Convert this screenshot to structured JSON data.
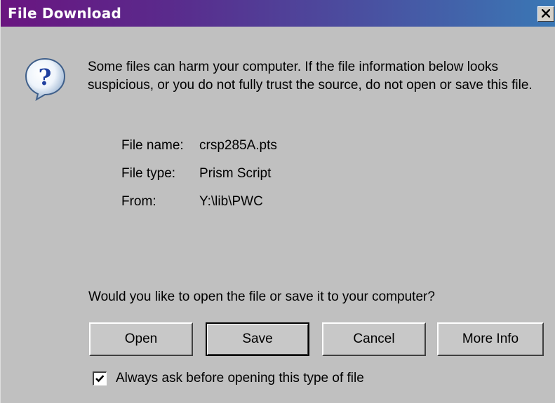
{
  "window": {
    "title": "File Download",
    "close_glyph": "✕"
  },
  "icon": "question-icon",
  "message": "Some files can harm your computer. If the file information below looks suspicious, or you do not fully trust the source, do not open or save this file.",
  "file_info": {
    "name_label": "File name:",
    "name_value": "crsp285A.pts",
    "type_label": "File type:",
    "type_value": "Prism Script",
    "from_label": "From:",
    "from_value": "Y:\\lib\\PWC"
  },
  "prompt": "Would you like to open the file or save it to your computer?",
  "buttons": {
    "open": "Open",
    "save": "Save",
    "cancel": "Cancel",
    "more_info": "More Info"
  },
  "checkbox": {
    "label": "Always ask before opening this type of file",
    "checked": true
  },
  "colors": {
    "title_gradient_start": "#6a1580",
    "title_gradient_end": "#3a78b5",
    "dialog_bg": "#c0c0c0"
  }
}
